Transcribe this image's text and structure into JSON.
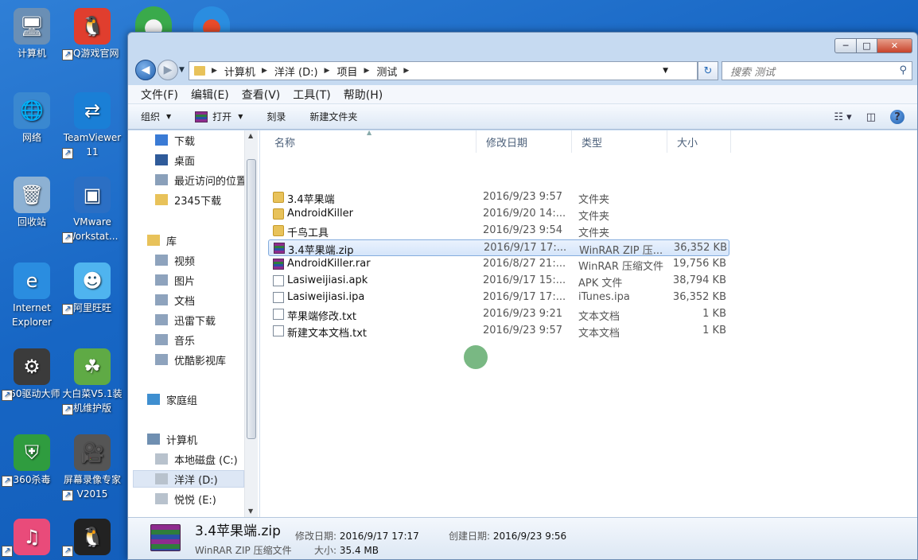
{
  "desktop": {
    "icons": [
      {
        "label": "计算机",
        "glyph": "🖥"
      },
      {
        "label": "QQ游戏官网",
        "glyph": "🐧"
      },
      {
        "label": "网络",
        "glyph": "🌐"
      },
      {
        "label": "TeamViewer 11",
        "glyph": "⇄"
      },
      {
        "label": "回收站",
        "glyph": "🗑"
      },
      {
        "label": "VMware Workstat...",
        "glyph": "▣"
      },
      {
        "label": "Internet Explorer",
        "glyph": "e"
      },
      {
        "label": "阿里旺旺",
        "glyph": "☻"
      },
      {
        "label": "360驱动大师",
        "glyph": "⚙"
      },
      {
        "label": "大白菜V5.1装机维护版",
        "glyph": "☘"
      },
      {
        "label": "360杀毒",
        "glyph": "⛨"
      },
      {
        "label": "屏幕录像专家V2015",
        "glyph": "🎥"
      },
      {
        "label": "",
        "glyph": "♫"
      },
      {
        "label": "",
        "glyph": "🐧"
      }
    ]
  },
  "window": {
    "title_buttons": {
      "minimize": "─",
      "maximize": "□",
      "close": "✕"
    },
    "address": {
      "crumbs": [
        "计算机",
        "洋洋 (D:)",
        "项目",
        "测试"
      ]
    },
    "search_placeholder": "搜索 测试",
    "menu": [
      "文件(F)",
      "编辑(E)",
      "查看(V)",
      "工具(T)",
      "帮助(H)"
    ],
    "toolbar": {
      "organize": "组织",
      "open": "打开",
      "burn": "刻录",
      "new_folder": "新建文件夹"
    },
    "nav": {
      "favorites": [
        {
          "label": "下载",
          "color": "#3a7bd5"
        },
        {
          "label": "桌面",
          "color": "#2f5b9a"
        },
        {
          "label": "最近访问的位置",
          "color": "#8aa0ba"
        },
        {
          "label": "2345下载",
          "color": "#e8c25a"
        }
      ],
      "library_title": "库",
      "libraries": [
        "视频",
        "图片",
        "文档",
        "迅雷下载",
        "音乐",
        "优酷影视库"
      ],
      "homegroup": "家庭组",
      "computer_title": "计算机",
      "drives": [
        "本地磁盘 (C:)",
        "洋洋 (D:)",
        "悦悦 (E:)"
      ]
    },
    "columns": {
      "name": "名称",
      "date": "修改日期",
      "type": "类型",
      "size": "大小"
    },
    "files": [
      {
        "name": "3.4苹果端",
        "date": "2016/9/23 9:57",
        "type": "文件夹",
        "size": "",
        "kind": "folder"
      },
      {
        "name": "AndroidKiller",
        "date": "2016/9/20 14:...",
        "type": "文件夹",
        "size": "",
        "kind": "folder"
      },
      {
        "name": "千鸟工具",
        "date": "2016/9/23 9:54",
        "type": "文件夹",
        "size": "",
        "kind": "folder"
      },
      {
        "name": "3.4苹果端.zip",
        "date": "2016/9/17 17:...",
        "type": "WinRAR ZIP 压...",
        "size": "36,352 KB",
        "kind": "rar",
        "selected": true
      },
      {
        "name": "AndroidKiller.rar",
        "date": "2016/8/27 21:...",
        "type": "WinRAR 压缩文件",
        "size": "19,756 KB",
        "kind": "rar"
      },
      {
        "name": "Lasiweijiasi.apk",
        "date": "2016/9/17 15:...",
        "type": "APK 文件",
        "size": "38,794 KB",
        "kind": "doc"
      },
      {
        "name": "Lasiweijiasi.ipa",
        "date": "2016/9/17 17:...",
        "type": "iTunes.ipa",
        "size": "36,352 KB",
        "kind": "doc"
      },
      {
        "name": "苹果端修改.txt",
        "date": "2016/9/23 9:21",
        "type": "文本文档",
        "size": "1 KB",
        "kind": "doc"
      },
      {
        "name": "新建文本文档.txt",
        "date": "2016/9/23 9:57",
        "type": "文本文档",
        "size": "1 KB",
        "kind": "doc"
      }
    ],
    "details": {
      "name": "3.4苹果端.zip",
      "type": "WinRAR ZIP 压缩文件",
      "modified_label": "修改日期:",
      "modified": "2016/9/17 17:17",
      "created_label": "创建日期:",
      "created": "2016/9/23 9:56",
      "size_label": "大小:",
      "size": "35.4 MB"
    }
  }
}
